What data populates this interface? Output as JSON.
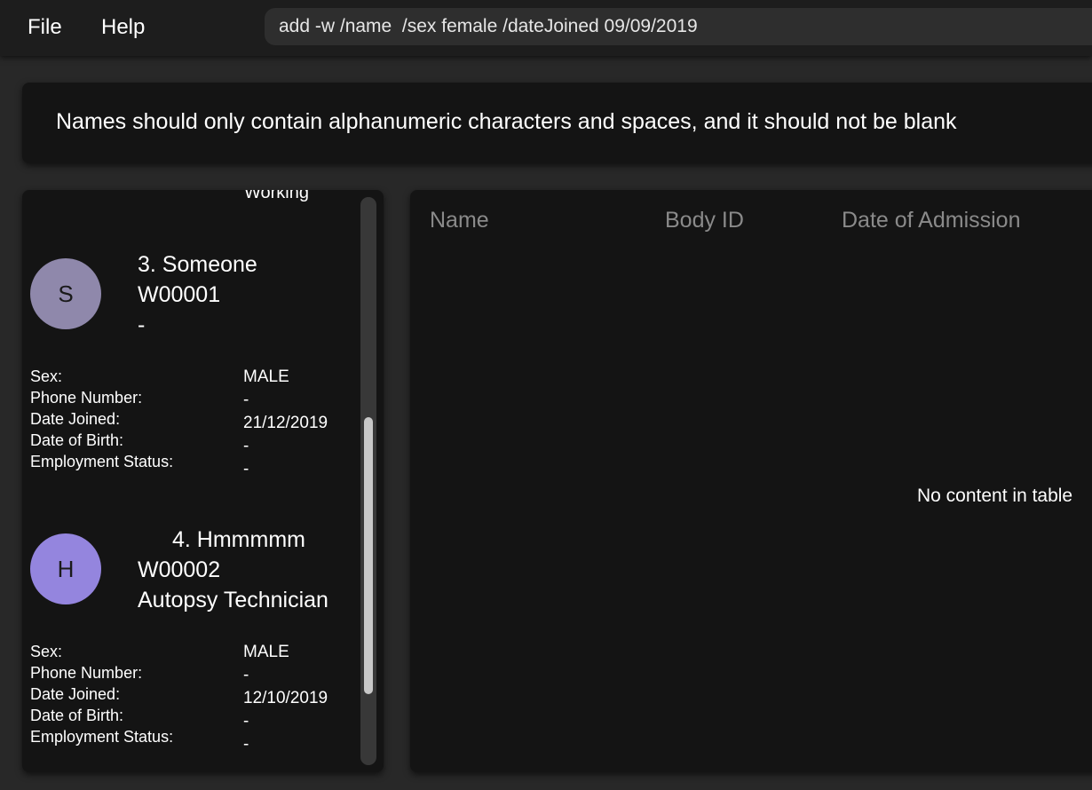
{
  "menu": {
    "file_label": "File",
    "help_label": "Help"
  },
  "command": {
    "value": "add -w /name  /sex female /dateJoined 09/09/2019"
  },
  "result": {
    "message": "Names should only contain alphanumeric characters and spaces, and it should not be blank"
  },
  "worker_list": {
    "cut_off_text": "Working",
    "field_labels": {
      "sex": "Sex:",
      "phone": "Phone Number:",
      "date_joined": "Date Joined:",
      "dob": "Date of Birth:",
      "employment": "Employment Status:"
    },
    "cards": [
      {
        "initial": "S",
        "avatar_color": "#8f88ab",
        "title": "3. Someone",
        "id": "W00001",
        "designation": "-",
        "sex": "MALE",
        "phone": "-",
        "date_joined": "21/12/2019",
        "dob": "-",
        "employment": "-"
      },
      {
        "initial": "H",
        "avatar_color": "#9485de",
        "title": "4. Hmmmmm",
        "id": "W00002",
        "designation": "Autopsy Technician",
        "sex": "MALE",
        "phone": "-",
        "date_joined": "12/10/2019",
        "dob": "-",
        "employment": "-"
      }
    ]
  },
  "body_table": {
    "columns": [
      "Name",
      "Body ID",
      "Date of Admission"
    ],
    "empty_message": "No content in table"
  }
}
